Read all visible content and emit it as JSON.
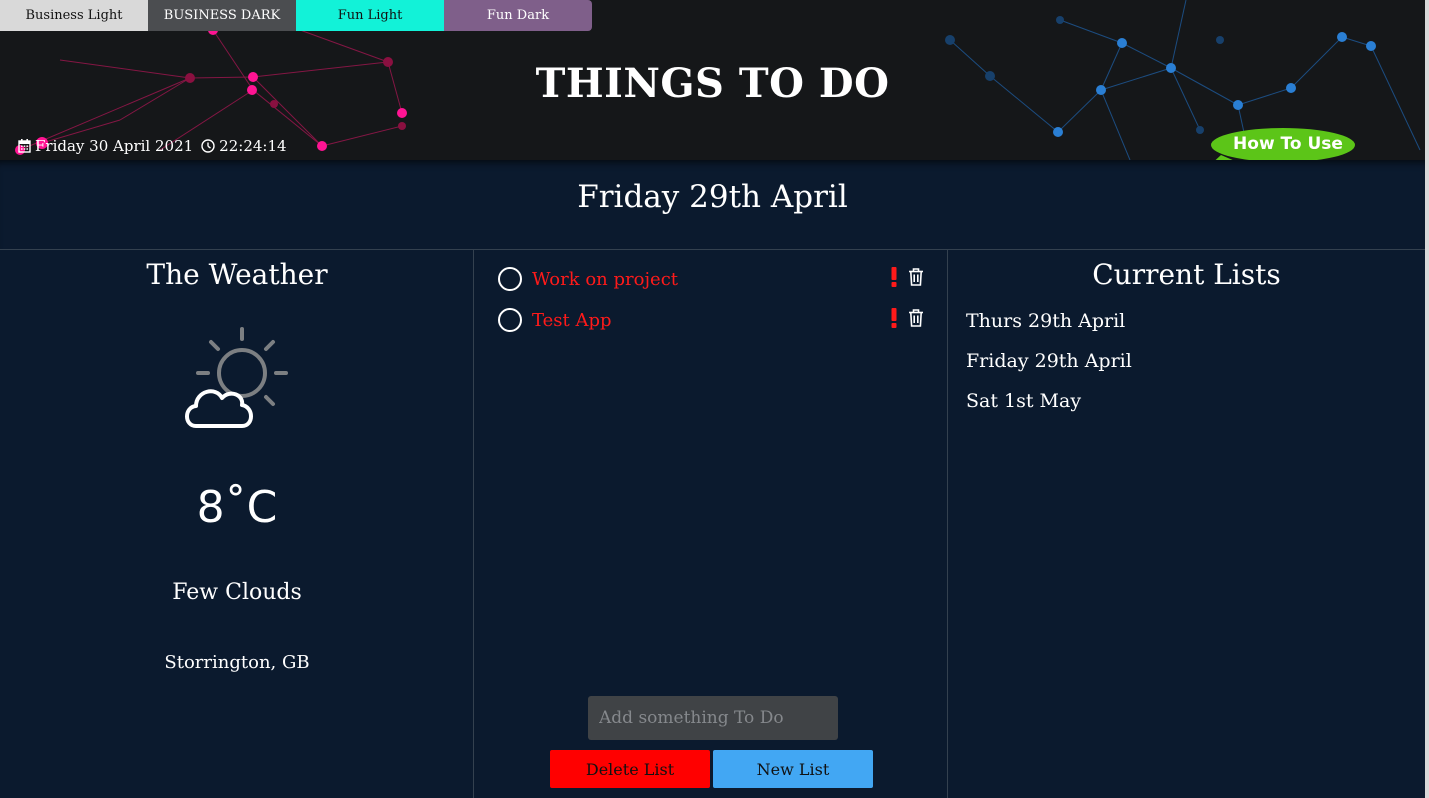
{
  "themes": {
    "business_light": "Business Light",
    "business_dark": "BUSINESS DARK",
    "fun_light": "Fun Light",
    "fun_dark": "Fun Dark"
  },
  "header": {
    "title": "THINGS TO DO",
    "date": "Friday 30 April 2021",
    "time": "22:24:14",
    "help_label": "How To Use"
  },
  "current_list": {
    "date": "Friday 29th April"
  },
  "weather": {
    "title": "The Weather",
    "icon": "partly-cloudy-icon",
    "temperature": "8˚C",
    "description": "Few Clouds",
    "location": "Storrington, GB"
  },
  "todos": [
    {
      "text": "Work on project",
      "important": true,
      "done": false
    },
    {
      "text": "Test App",
      "important": true,
      "done": false
    }
  ],
  "todo_input": {
    "placeholder": "Add something To Do",
    "value": ""
  },
  "buttons": {
    "delete_list": "Delete List",
    "new_list": "New List"
  },
  "lists": {
    "title": "Current Lists",
    "items": [
      "Thurs 29th April",
      "Friday 29th April",
      "Sat 1st May"
    ]
  },
  "colors": {
    "background": "#0b1a2e",
    "header": "#151719",
    "accent_green": "#5cc518",
    "delete_red": "#ff0000",
    "new_blue": "#42a7f3",
    "todo_text": "#ff1a1a"
  }
}
